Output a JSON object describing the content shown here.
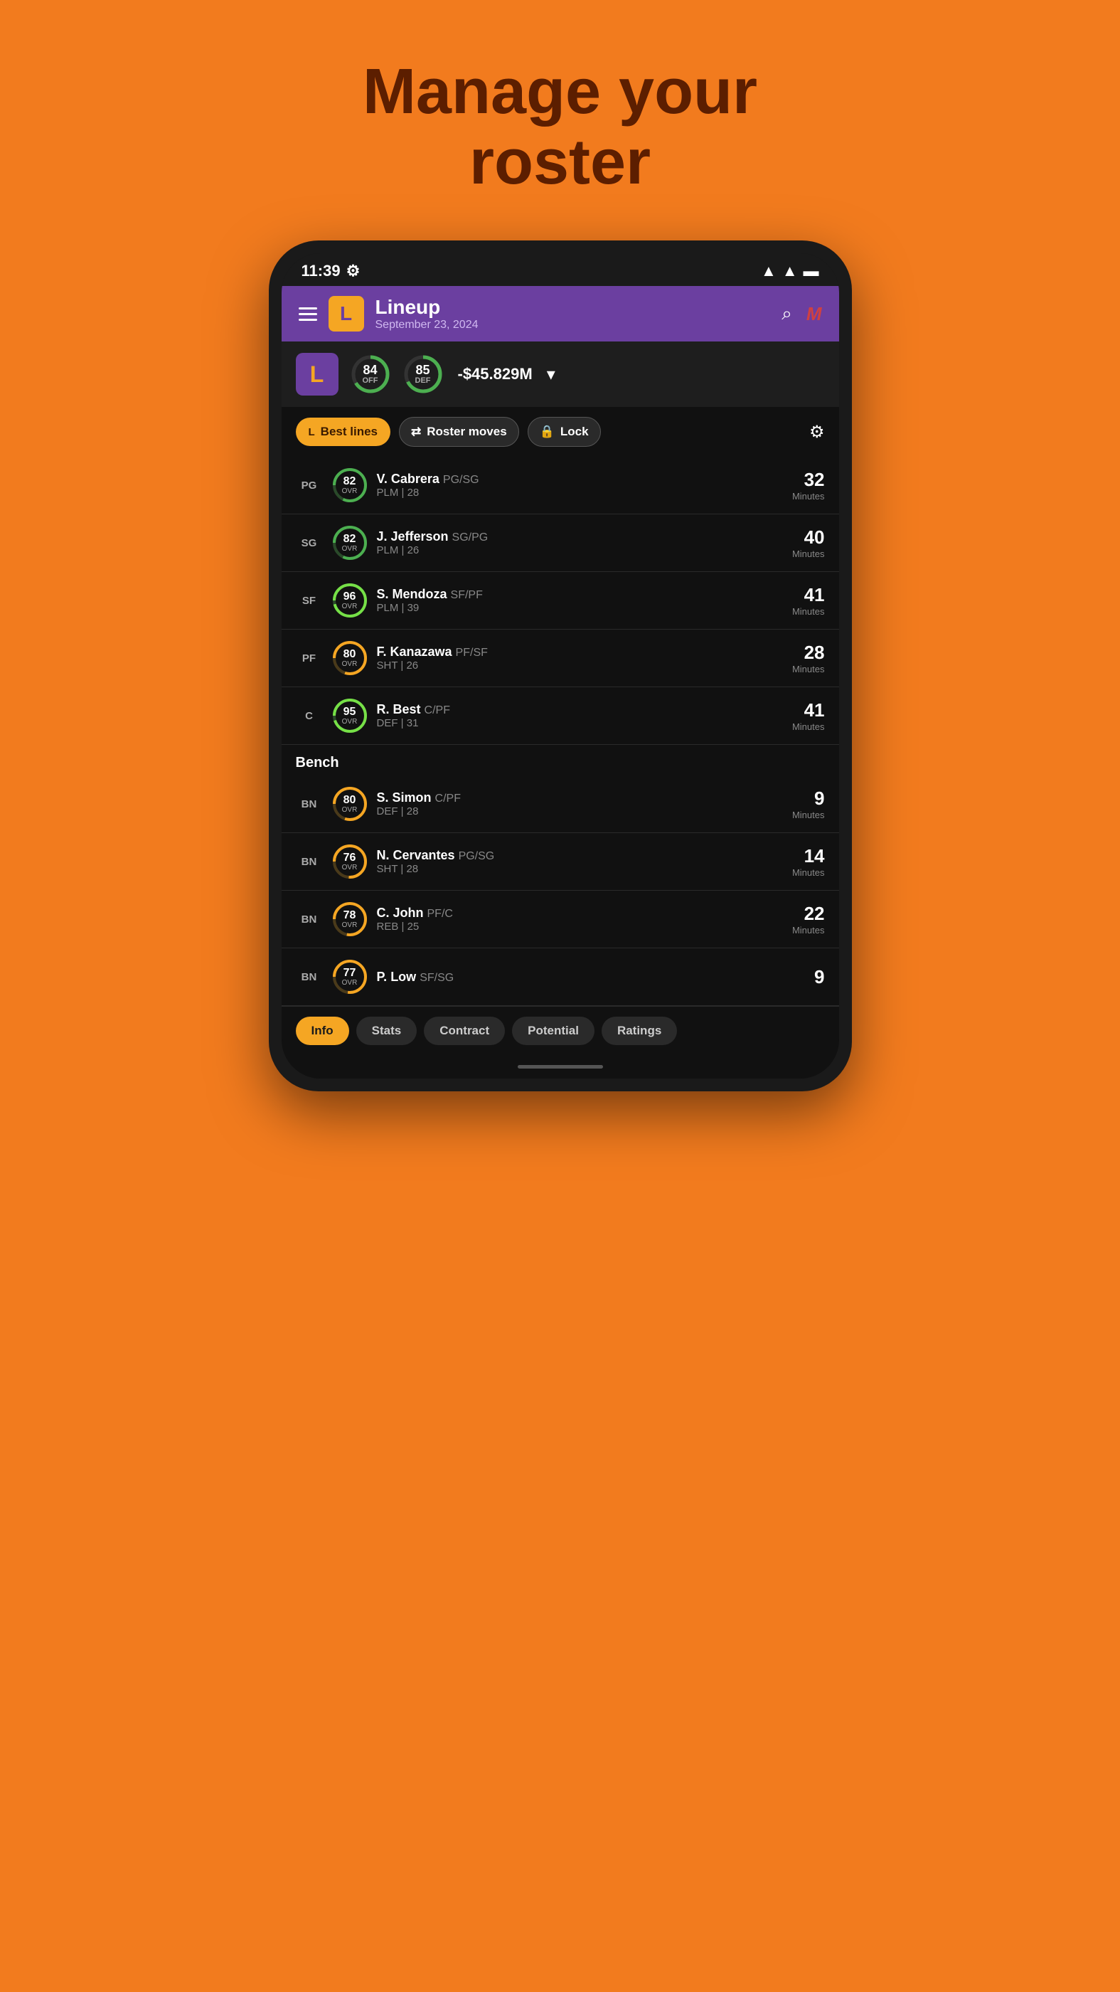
{
  "page": {
    "title_line1": "Manage your",
    "title_line2": "roster"
  },
  "status_bar": {
    "time": "11:39",
    "settings_icon": "⚙",
    "signal": "▲",
    "wifi": "▲",
    "battery": "▬"
  },
  "header": {
    "menu_icon": "hamburger",
    "logo_letter": "L",
    "title": "Lineup",
    "subtitle": "September 23, 2024",
    "search_icon": "search",
    "profile_icon": "M"
  },
  "team_summary": {
    "logo_letter": "L",
    "offense_rating": 84,
    "offense_label": "OFF",
    "defense_rating": 85,
    "defense_label": "DEF",
    "money": "-$45.829M",
    "expand_icon": "▾"
  },
  "action_row": {
    "best_lines_label": "Best lines",
    "roster_moves_label": "Roster moves",
    "lock_label": "Lock",
    "settings_icon": "⚙"
  },
  "players": [
    {
      "position": "PG",
      "rating": 82,
      "name": "V. Cabrera",
      "name_pos": "PG/SG",
      "detail": "PLM | 28",
      "minutes": 32,
      "ring_color": "#4CAF50",
      "ring_bg": "#2a4a2a"
    },
    {
      "position": "SG",
      "rating": 82,
      "name": "J. Jefferson",
      "name_pos": "SG/PG",
      "detail": "PLM | 26",
      "minutes": 40,
      "ring_color": "#4CAF50",
      "ring_bg": "#2a4a2a"
    },
    {
      "position": "SF",
      "rating": 96,
      "name": "S. Mendoza",
      "name_pos": "SF/PF",
      "detail": "PLM | 39",
      "minutes": 41,
      "ring_color": "#76E047",
      "ring_bg": "#2a4a2a"
    },
    {
      "position": "PF",
      "rating": 80,
      "name": "F. Kanazawa",
      "name_pos": "PF/SF",
      "detail": "SHT | 26",
      "minutes": 28,
      "ring_color": "#F5A623",
      "ring_bg": "#4a3a1a"
    },
    {
      "position": "C",
      "rating": 95,
      "name": "R. Best",
      "name_pos": "C/PF",
      "detail": "DEF | 31",
      "minutes": 41,
      "ring_color": "#76E047",
      "ring_bg": "#2a4a2a"
    }
  ],
  "bench_label": "Bench",
  "bench_players": [
    {
      "position": "BN",
      "rating": 80,
      "name": "S. Simon",
      "name_pos": "C/PF",
      "detail": "DEF | 28",
      "minutes": 9,
      "ring_color": "#F5A623",
      "ring_bg": "#4a3a1a"
    },
    {
      "position": "BN",
      "rating": 76,
      "name": "N. Cervantes",
      "name_pos": "PG/SG",
      "detail": "SHT | 28",
      "minutes": 14,
      "ring_color": "#F5A623",
      "ring_bg": "#4a3a1a"
    },
    {
      "position": "BN",
      "rating": 78,
      "name": "C. John",
      "name_pos": "PF/C",
      "detail": "REB | 25",
      "minutes": 22,
      "ring_color": "#F5A623",
      "ring_bg": "#4a3a1a"
    },
    {
      "position": "BN",
      "rating": 77,
      "name": "P. Low",
      "name_pos": "SF/SG",
      "detail": "",
      "minutes": 9,
      "ring_color": "#F5A623",
      "ring_bg": "#4a3a1a"
    }
  ],
  "tabs": {
    "items": [
      "Info",
      "Stats",
      "Contract",
      "Potential",
      "Ratings"
    ],
    "active": 0
  }
}
